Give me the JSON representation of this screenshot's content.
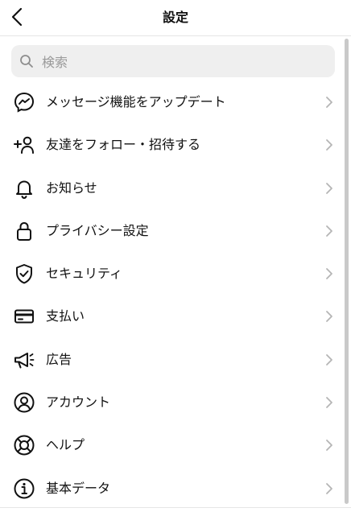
{
  "header": {
    "title": "設定"
  },
  "search": {
    "placeholder": "検索"
  },
  "menu": [
    {
      "label": "メッセージ機能をアップデート",
      "icon": "messenger-icon"
    },
    {
      "label": "友達をフォロー・招待する",
      "icon": "add-person-icon"
    },
    {
      "label": "お知らせ",
      "icon": "bell-icon"
    },
    {
      "label": "プライバシー設定",
      "icon": "lock-icon"
    },
    {
      "label": "セキュリティ",
      "icon": "shield-check-icon"
    },
    {
      "label": "支払い",
      "icon": "credit-card-icon"
    },
    {
      "label": "広告",
      "icon": "megaphone-icon"
    },
    {
      "label": "アカウント",
      "icon": "account-circle-icon"
    },
    {
      "label": "ヘルプ",
      "icon": "lifebuoy-icon"
    },
    {
      "label": "基本データ",
      "icon": "info-icon"
    }
  ]
}
